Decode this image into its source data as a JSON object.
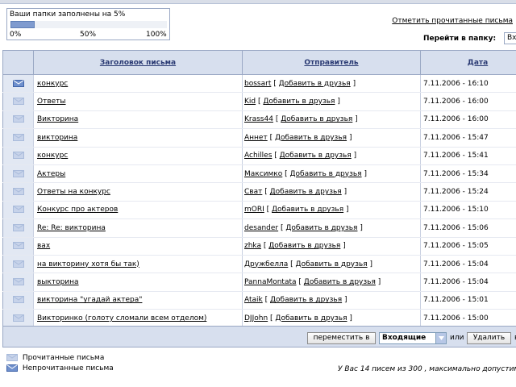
{
  "quota": {
    "label": "Ваши папки заполнены на 5%",
    "percent": 5,
    "ticks": [
      "0%",
      "50%",
      "100%"
    ]
  },
  "header": {
    "mark_read_link": "Отметить прочитанные письма",
    "goto_label": "Перейти в папку:",
    "goto_value": "Вх"
  },
  "table": {
    "columns": [
      "Заголовок письма",
      "Отправитель",
      "Дата"
    ],
    "add_friend": "Добавить в друзья",
    "rows": [
      {
        "subject": "конкурс",
        "sender": "bossart",
        "date": "7.11.2006 - 16:10",
        "unread": true
      },
      {
        "subject": "Ответы",
        "sender": "Kid",
        "date": "7.11.2006 - 16:00",
        "unread": false
      },
      {
        "subject": "Викторина",
        "sender": "Krass44",
        "date": "7.11.2006 - 16:00",
        "unread": false
      },
      {
        "subject": "викторина",
        "sender": "Аннет",
        "date": "7.11.2006 - 15:47",
        "unread": false
      },
      {
        "subject": "конкурс",
        "sender": "Achilles",
        "date": "7.11.2006 - 15:41",
        "unread": false
      },
      {
        "subject": "Актеры",
        "sender": "Максимко",
        "date": "7.11.2006 - 15:34",
        "unread": false
      },
      {
        "subject": "Ответы на конкурс",
        "sender": "Сват",
        "date": "7.11.2006 - 15:24",
        "unread": false
      },
      {
        "subject": "Конкурс про актеров",
        "sender": "mORI",
        "date": "7.11.2006 - 15:10",
        "unread": false
      },
      {
        "subject": "Re: Re: викторина",
        "sender": "desander",
        "date": "7.11.2006 - 15:06",
        "unread": false
      },
      {
        "subject": "вах",
        "sender": "zhka",
        "date": "7.11.2006 - 15:05",
        "unread": false
      },
      {
        "subject": "на викторину хотя бы так)",
        "sender": "Дружбелла",
        "date": "7.11.2006 - 15:04",
        "unread": false
      },
      {
        "subject": "выкторина",
        "sender": "PannaMontata",
        "date": "7.11.2006 - 15:04",
        "unread": false
      },
      {
        "subject": "викторина \"угадай актера\"",
        "sender": "Ataik",
        "date": "7.11.2006 - 15:01",
        "unread": false
      },
      {
        "subject": "Викторинко (голоту сломали всем отделом)",
        "sender": "DJJohn",
        "date": "7.11.2006 - 15:00",
        "unread": false
      }
    ]
  },
  "actions": {
    "move_label": "переместить в",
    "folder_value": "Входящие",
    "or_label": "или",
    "delete_label": "Удалить",
    "trail": "в"
  },
  "legend": {
    "read": "Прочитанные письма",
    "unread": "Непрочитанные письма"
  },
  "footer": {
    "note": "У Вас 14 писем из 300 , максимально допустим"
  },
  "colors": {
    "header_bg": "#d7dfee",
    "border": "#9aa8c4",
    "unread_envelope": "#5a7fc0",
    "read_envelope": "#a9bbdb"
  }
}
